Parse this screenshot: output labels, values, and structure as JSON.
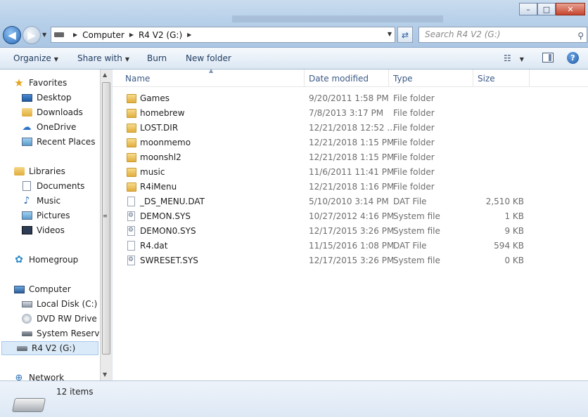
{
  "window": {
    "minimize_glyph": "–",
    "maximize_glyph": "□",
    "close_glyph": "✕"
  },
  "address": {
    "crumbs": [
      "Computer",
      "R4 V2 (G:)"
    ],
    "search_placeholder": "Search R4 V2 (G:)"
  },
  "toolbar": {
    "organize": "Organize",
    "share_with": "Share with",
    "burn": "Burn",
    "new_folder": "New folder"
  },
  "sidebar": {
    "favorites": "Favorites",
    "desktop": "Desktop",
    "downloads": "Downloads",
    "onedrive": "OneDrive",
    "recent_places": "Recent Places",
    "libraries": "Libraries",
    "documents": "Documents",
    "music": "Music",
    "pictures": "Pictures",
    "videos": "Videos",
    "homegroup": "Homegroup",
    "computer": "Computer",
    "local_disk": "Local Disk (C:)",
    "dvd_drive": "DVD RW Drive (D",
    "system_reserved": "System Reserved",
    "r4": "R4 V2 (G:)",
    "network": "Network"
  },
  "columns": {
    "name": "Name",
    "date": "Date modified",
    "type": "Type",
    "size": "Size"
  },
  "files": [
    {
      "name": "Games",
      "date": "9/20/2011 1:58 PM",
      "type": "File folder",
      "size": "",
      "kind": "folder"
    },
    {
      "name": "homebrew",
      "date": "7/8/2013 3:17 PM",
      "type": "File folder",
      "size": "",
      "kind": "folder"
    },
    {
      "name": "LOST.DIR",
      "date": "12/21/2018 12:52 ...",
      "type": "File folder",
      "size": "",
      "kind": "folder"
    },
    {
      "name": "moonmemo",
      "date": "12/21/2018 1:15 PM",
      "type": "File folder",
      "size": "",
      "kind": "folder"
    },
    {
      "name": "moonshl2",
      "date": "12/21/2018 1:15 PM",
      "type": "File folder",
      "size": "",
      "kind": "folder"
    },
    {
      "name": "music",
      "date": "11/6/2011 11:41 PM",
      "type": "File folder",
      "size": "",
      "kind": "folder"
    },
    {
      "name": "R4iMenu",
      "date": "12/21/2018 1:16 PM",
      "type": "File folder",
      "size": "",
      "kind": "folder"
    },
    {
      "name": "_DS_MENU.DAT",
      "date": "5/10/2010 3:14 PM",
      "type": "DAT File",
      "size": "2,510 KB",
      "kind": "file"
    },
    {
      "name": "DEMON.SYS",
      "date": "10/27/2012 4:16 PM",
      "type": "System file",
      "size": "1 KB",
      "kind": "sys"
    },
    {
      "name": "DEMON0.SYS",
      "date": "12/17/2015 3:26 PM",
      "type": "System file",
      "size": "9 KB",
      "kind": "sys"
    },
    {
      "name": "R4.dat",
      "date": "11/15/2016 1:08 PM",
      "type": "DAT File",
      "size": "594 KB",
      "kind": "file"
    },
    {
      "name": "SWRESET.SYS",
      "date": "12/17/2015 3:26 PM",
      "type": "System file",
      "size": "0 KB",
      "kind": "sys"
    }
  ],
  "status": {
    "item_count": "12 items"
  }
}
